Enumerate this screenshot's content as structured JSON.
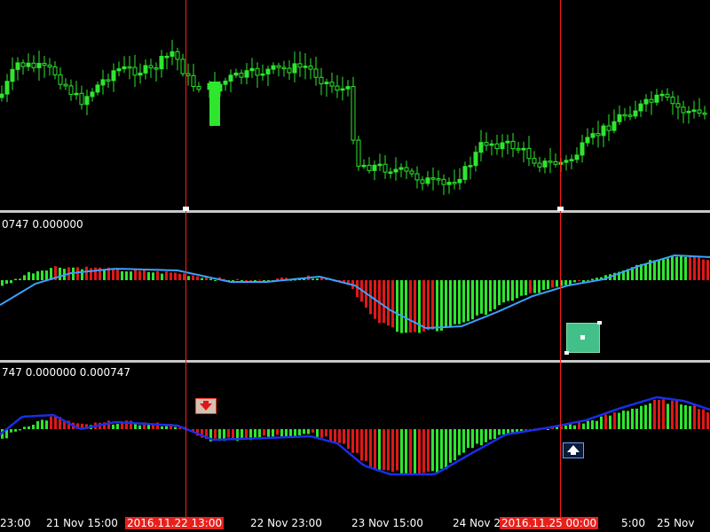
{
  "panels": {
    "macd1_header": "0747 0.000000",
    "macd2_header": "747 0.000000 0.000747"
  },
  "time_axis": [
    {
      "label": "23:00",
      "highlight": false
    },
    {
      "label": "21 Nov 15:00",
      "highlight": false
    },
    {
      "label": "2016.11.22 13:00",
      "highlight": true
    },
    {
      "label": "22 Nov 23:00",
      "highlight": false
    },
    {
      "label": "23 Nov 15:00",
      "highlight": false
    },
    {
      "label": "24 Nov 2",
      "highlight": false
    },
    {
      "label": "2016.11.25 00:00",
      "highlight": true
    },
    {
      "label": "5:00",
      "highlight": false
    },
    {
      "label": "25 Nov",
      "highlight": false
    }
  ],
  "colors": {
    "bull": "#2ee62e",
    "bear": "#e01818",
    "signal_light": "#3ca0ff",
    "signal_dark": "#1a2ee6",
    "vline": "#ff1a1a",
    "background": "#000000"
  },
  "icons": {
    "buy_arrow_icon": "up-arrow-marker",
    "sell_arrow_icon": "down-arrow-marker",
    "green_square_icon": "object-marker"
  }
}
